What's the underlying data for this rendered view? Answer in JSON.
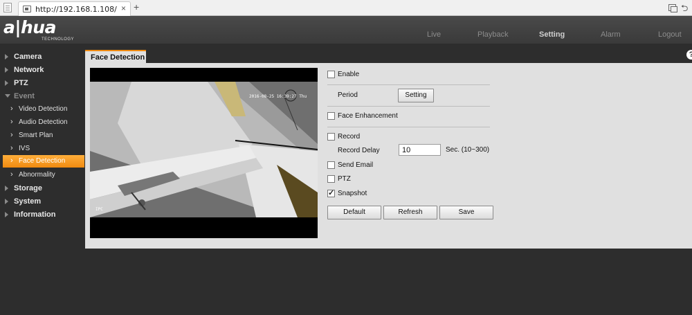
{
  "browser": {
    "url": "http://192.168.1.108/",
    "close": "×",
    "new_tab": "+",
    "back": "⮌"
  },
  "brand": {
    "logo": "a|hua",
    "subtitle": "TECHNOLOGY"
  },
  "nav": {
    "live": "Live",
    "playback": "Playback",
    "setting": "Setting",
    "alarm": "Alarm",
    "logout": "Logout"
  },
  "sidebar": {
    "camera": "Camera",
    "network": "Network",
    "ptz": "PTZ",
    "event": "Event",
    "event_items": [
      "Video Detection",
      "Audio Detection",
      "Smart Plan",
      "IVS",
      "Face Detection",
      "Abnormality"
    ],
    "storage": "Storage",
    "system": "System",
    "information": "Information",
    "chevron": "›"
  },
  "main": {
    "tab_title": "Face Detection",
    "help": "?"
  },
  "video": {
    "timestamp": "2016-08-25 16:39:27 Thu",
    "channel": "IPC"
  },
  "form": {
    "enable_label": "Enable",
    "enable_checked": false,
    "period_label": "Period",
    "setting_button": "Setting",
    "face_enhancement_label": "Face Enhancement",
    "face_enhancement_checked": false,
    "record_label": "Record",
    "record_checked": false,
    "record_delay_label": "Record Delay",
    "record_delay_value": "10",
    "record_delay_range": "Sec. (10~300)",
    "send_email_label": "Send Email",
    "send_email_checked": false,
    "ptz_label": "PTZ",
    "ptz_checked": false,
    "snapshot_label": "Snapshot",
    "snapshot_checked": true
  },
  "buttons": {
    "default": "Default",
    "refresh": "Refresh",
    "save": "Save"
  },
  "colors": {
    "accent": "#f08a10",
    "panel": "#e0e0e0",
    "background": "#2d2d2d"
  }
}
